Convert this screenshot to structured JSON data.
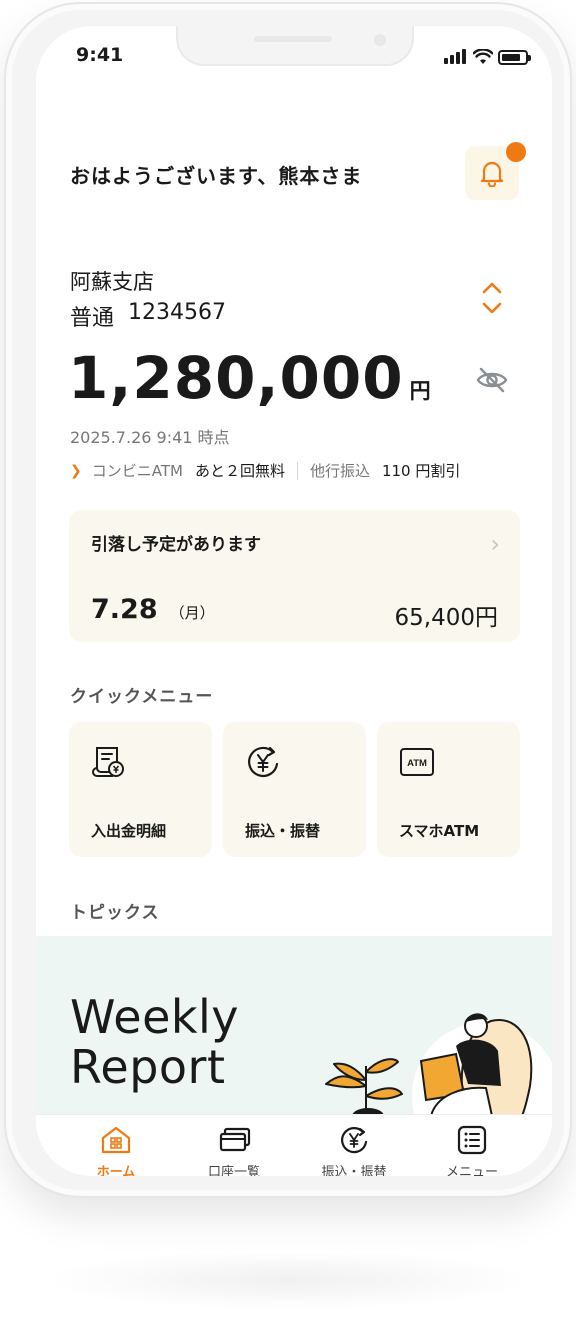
{
  "status_bar": {
    "time": "9:41"
  },
  "header": {
    "greeting": "おはようございます、熊本さま"
  },
  "account": {
    "branch": "阿蘇支店",
    "type": "普通",
    "number": "1234567",
    "balance": "1,280,000",
    "currency_unit": "円",
    "as_of": "2025.7.26 9:41 時点"
  },
  "benefits": {
    "atm_label": "コンビニATM",
    "atm_value": "あと２回無料",
    "transfer_label": "他行振込",
    "transfer_value": "110 円割引"
  },
  "scheduled_debit": {
    "title": "引落し予定があります",
    "date": "7.28",
    "weekday": "（月）",
    "amount": "65,400円"
  },
  "quick_menu": {
    "title": "クイックメニュー",
    "items": [
      {
        "label": "入出金明細",
        "icon": "statement-icon"
      },
      {
        "label": "振込・振替",
        "icon": "yen-transfer-icon"
      },
      {
        "label": "スマホATM",
        "icon": "atm-icon"
      }
    ]
  },
  "topics": {
    "title": "トピックス",
    "banner_line1": "Weekly",
    "banner_line2": "Report"
  },
  "tab_bar": {
    "items": [
      {
        "label": "ホーム",
        "icon": "home-icon",
        "active": true
      },
      {
        "label": "口座一覧",
        "icon": "cards-icon",
        "active": false
      },
      {
        "label": "振込・振替",
        "icon": "yen-transfer-icon",
        "active": false
      },
      {
        "label": "メニュー",
        "icon": "menu-list-icon",
        "active": false
      }
    ]
  },
  "colors": {
    "accent": "#ef7a14",
    "card_bg": "#faf8ee",
    "banner_bg": "#edf6f3"
  }
}
